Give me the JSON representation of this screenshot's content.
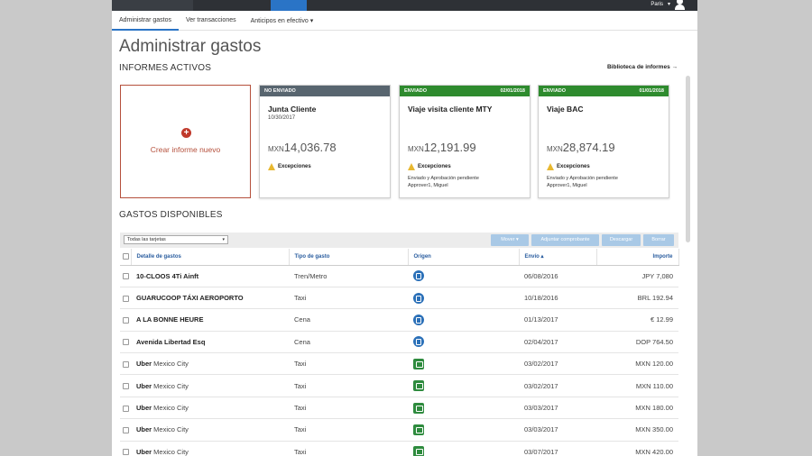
{
  "topbar": {
    "user_name": "Paris",
    "user_caret": "▾"
  },
  "nav": {
    "items": [
      {
        "label": "Administrar gastos"
      },
      {
        "label": "Ver transacciones"
      },
      {
        "label": "Anticipos en efectivo ▾"
      }
    ]
  },
  "page": {
    "title": "Administrar gastos"
  },
  "reports": {
    "section_title": "INFORMES ACTIVOS",
    "library_link": "Biblioteca de informes →",
    "new_report": {
      "plus": "+",
      "label": "Crear informe nuevo"
    },
    "cards": [
      {
        "status": "NO ENVIADO",
        "status_date": "",
        "status_color": "#58656f",
        "title": "Junta Cliente",
        "date": "10/30/2017",
        "currency": "MXN",
        "amount": "14,036.78",
        "exceptions": "Excepciones",
        "line1": "",
        "line2": ""
      },
      {
        "status": "ENVIADO",
        "status_date": "02/01/2018",
        "status_color": "#2e8b2e",
        "title": "Viaje visita cliente MTY",
        "date": "",
        "currency": "MXN",
        "amount": "12,191.99",
        "exceptions": "Excepciones",
        "line1": "Enviado y Aprobación pendiente",
        "line2": "Approver1, Miguel"
      },
      {
        "status": "ENVIADO",
        "status_date": "01/01/2018",
        "status_color": "#2e8b2e",
        "title": "Viaje BAC",
        "date": "",
        "currency": "MXN",
        "amount": "28,874.19",
        "exceptions": "Excepciones",
        "line1": "Enviado y Aprobación pendiente",
        "line2": "Approver1, Miguel"
      }
    ]
  },
  "expenses": {
    "section_title": "GASTOS DISPONIBLES",
    "filter_value": "Todas las tarjetas",
    "buttons": [
      "Mover ▾",
      "Adjuntar comprobante",
      "Descargar",
      "Borrar"
    ],
    "columns": [
      "Detalle de gastos",
      "Tipo de gasto",
      "Origen",
      "Envío ▴",
      "Importe"
    ],
    "rows": [
      {
        "detail": "10-CLOOS 4Ti Ainft",
        "detail_light": "",
        "type": "Tren/Metro",
        "origin": "card",
        "date": "06/08/2016",
        "amount": "JPY 7,080"
      },
      {
        "detail": "GUARUCOOP TÁXI AEROPORTO",
        "detail_light": "",
        "type": "Taxi",
        "origin": "card",
        "date": "10/18/2016",
        "amount": "BRL 192.94"
      },
      {
        "detail": "A LA BONNE HEURE",
        "detail_light": "",
        "type": "Cena",
        "origin": "card",
        "date": "01/13/2017",
        "amount": "€ 12.99"
      },
      {
        "detail": "Avenida Libertad Esq",
        "detail_light": "",
        "type": "Cena",
        "origin": "card",
        "date": "02/04/2017",
        "amount": "DOP 764.50"
      },
      {
        "detail": "Uber",
        "detail_light": " Mexico City",
        "type": "Taxi",
        "origin": "receipt",
        "date": "03/02/2017",
        "amount": "MXN 120.00"
      },
      {
        "detail": "Uber",
        "detail_light": " Mexico City",
        "type": "Taxi",
        "origin": "receipt",
        "date": "03/02/2017",
        "amount": "MXN 110.00"
      },
      {
        "detail": "Uber",
        "detail_light": " Mexico City",
        "type": "Taxi",
        "origin": "receipt",
        "date": "03/03/2017",
        "amount": "MXN 180.00"
      },
      {
        "detail": "Uber",
        "detail_light": " Mexico City",
        "type": "Taxi",
        "origin": "receipt",
        "date": "03/03/2017",
        "amount": "MXN 350.00"
      },
      {
        "detail": "Uber",
        "detail_light": " Mexico City",
        "type": "Taxi",
        "origin": "receipt",
        "date": "03/07/2017",
        "amount": "MXN 420.00"
      }
    ]
  }
}
